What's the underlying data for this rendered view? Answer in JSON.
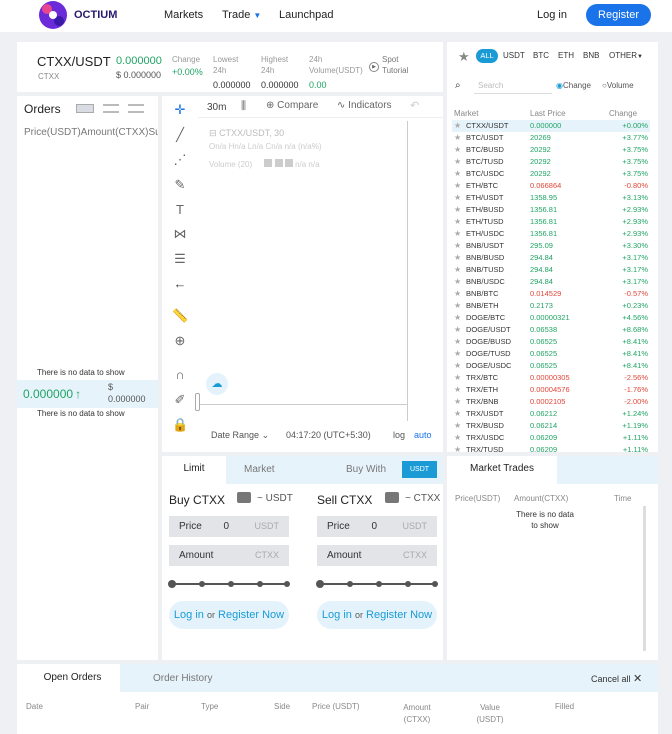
{
  "header": {
    "logo_text": "OCTIUM",
    "nav": [
      "Markets",
      "Trade",
      "Launchpad"
    ],
    "login": "Log in",
    "register": "Register"
  },
  "ticker": {
    "pair": "CTXX/USDT",
    "base": "CTXX",
    "price": "0.000000",
    "price_usd": "$ 0.000000",
    "change_label": "Change",
    "change_value": "+0.00%",
    "lowest_label": "Lowest 24h",
    "lowest_value": "0.000000",
    "highest_label": "Highest 24h",
    "highest_value": "0.000000",
    "volume_label": "24h Volume(USDT)",
    "volume_value": "0.00",
    "tutorial": "Spot Tutorial"
  },
  "orders": {
    "title": "Orders",
    "col_headers": "Price(USDT)Amount(CTXX)Su",
    "no_data_top": "There is no data to show",
    "no_data_bottom": "There is no data to show",
    "mid_price": "0.000000",
    "mid_usd_symbol": "$",
    "mid_usd": "0.000000"
  },
  "chart": {
    "interval": "30m",
    "compare": "Compare",
    "indicators": "Indicators",
    "legend_title": "CTXX/USDT, 30",
    "legend_ohlc": "On/a  Hn/a  Ln/a  Cn/a  n/a (n/a%)",
    "volume_label": "Volume (20)",
    "volume_value": "n/a  n/a",
    "date_range": "Date Range",
    "time": "04:17:20 (UTC+5:30)",
    "log": "log",
    "auto": "auto"
  },
  "market_filter": {
    "tabs": [
      "ALL",
      "USDT",
      "BTC",
      "ETH",
      "BNB",
      "OTHER"
    ],
    "search_placeholder": "Search",
    "radio_change": "Change",
    "radio_volume": "Volume",
    "col_market": "Market",
    "col_price": "Last Price",
    "col_change": "Change"
  },
  "markets": [
    {
      "pair": "CTXX/USDT",
      "price": "0.000000",
      "change": "+0.00%",
      "up": true,
      "selected": true
    },
    {
      "pair": "BTC/USDT",
      "price": "20269",
      "change": "+3.77%",
      "up": true
    },
    {
      "pair": "BTC/BUSD",
      "price": "20292",
      "change": "+3.75%",
      "up": true
    },
    {
      "pair": "BTC/TUSD",
      "price": "20292",
      "change": "+3.75%",
      "up": true
    },
    {
      "pair": "BTC/USDC",
      "price": "20292",
      "change": "+3.75%",
      "up": true
    },
    {
      "pair": "ETH/BTC",
      "price": "0.066864",
      "change": "-0.80%",
      "up": false
    },
    {
      "pair": "ETH/USDT",
      "price": "1358.95",
      "change": "+3.13%",
      "up": true
    },
    {
      "pair": "ETH/BUSD",
      "price": "1356.81",
      "change": "+2.93%",
      "up": true
    },
    {
      "pair": "ETH/TUSD",
      "price": "1356.81",
      "change": "+2.93%",
      "up": true
    },
    {
      "pair": "ETH/USDC",
      "price": "1356.81",
      "change": "+2.93%",
      "up": true
    },
    {
      "pair": "BNB/USDT",
      "price": "295.09",
      "change": "+3.30%",
      "up": true
    },
    {
      "pair": "BNB/BUSD",
      "price": "294.84",
      "change": "+3.17%",
      "up": true
    },
    {
      "pair": "BNB/TUSD",
      "price": "294.84",
      "change": "+3.17%",
      "up": true
    },
    {
      "pair": "BNB/USDC",
      "price": "294.84",
      "change": "+3.17%",
      "up": true
    },
    {
      "pair": "BNB/BTC",
      "price": "0.014529",
      "change": "-0.57%",
      "up": false
    },
    {
      "pair": "BNB/ETH",
      "price": "0.2173",
      "change": "+0.23%",
      "up": true
    },
    {
      "pair": "DOGE/BTC",
      "price": "0.00000321",
      "change": "+4.56%",
      "up": true
    },
    {
      "pair": "DOGE/USDT",
      "price": "0.06538",
      "change": "+8.68%",
      "up": true
    },
    {
      "pair": "DOGE/BUSD",
      "price": "0.06525",
      "change": "+8.41%",
      "up": true
    },
    {
      "pair": "DOGE/TUSD",
      "price": "0.06525",
      "change": "+8.41%",
      "up": true
    },
    {
      "pair": "DOGE/USDC",
      "price": "0.06525",
      "change": "+8.41%",
      "up": true
    },
    {
      "pair": "TRX/BTC",
      "price": "0.00000305",
      "change": "-2.56%",
      "up": false
    },
    {
      "pair": "TRX/ETH",
      "price": "0.00004576",
      "change": "-1.76%",
      "up": false
    },
    {
      "pair": "TRX/BNB",
      "price": "0.0002105",
      "change": "-2.00%",
      "up": false
    },
    {
      "pair": "TRX/USDT",
      "price": "0.06212",
      "change": "+1.24%",
      "up": true
    },
    {
      "pair": "TRX/BUSD",
      "price": "0.06214",
      "change": "+1.19%",
      "up": true
    },
    {
      "pair": "TRX/USDC",
      "price": "0.06209",
      "change": "+1.11%",
      "up": true
    },
    {
      "pair": "TRX/TUSD",
      "price": "0.06209",
      "change": "+1.11%",
      "up": true
    }
  ],
  "trade": {
    "tab_limit": "Limit",
    "tab_market": "Market",
    "buy_with": "Buy With",
    "buy_with_value": "USDT",
    "buy_title": "Buy CTXX",
    "buy_balance": "~ USDT",
    "sell_title": "Sell CTXX",
    "sell_balance": "~ CTXX",
    "price_label": "Price",
    "price_value": "0",
    "amount_label": "Amount",
    "unit_usdt": "USDT",
    "unit_ctxx": "CTXX",
    "login": "Log in",
    "or": "or",
    "register_now": "Register Now"
  },
  "market_trades": {
    "title": "Market Trades",
    "col_price": "Price(USDT)",
    "col_amount": "Amount(CTXX)",
    "col_time": "Time",
    "no_data": "There is no data to show"
  },
  "bottom": {
    "tab_open": "Open Orders",
    "tab_history": "Order History",
    "cancel_all": "Cancel all",
    "cols": [
      "Date",
      "Pair",
      "Type",
      "Side",
      "Price (USDT)",
      "Amount (CTXX)",
      "Value (USDT)",
      "Filled"
    ]
  }
}
